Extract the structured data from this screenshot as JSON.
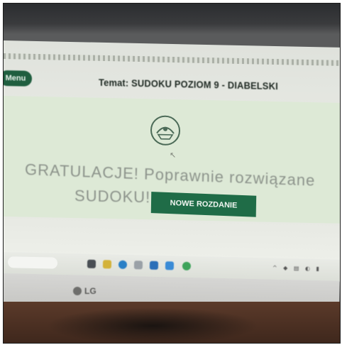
{
  "back_button_label": "Menu",
  "page_title": "Temat: SUDOKU POZIOM 9 - DIABELSKI",
  "message_line1": "GRATULACJE! Poprawnie rozwiązane",
  "message_line2": "SUDOKU!",
  "new_game_button": "NOWE ROZDANIE",
  "monitor_brand": "LG",
  "colors": {
    "accent_green": "#1f6c47",
    "panel_green": "#dde9d6",
    "message_gray": "#8c938b"
  },
  "taskbar_icons": [
    "windows-icon",
    "file-explorer-icon",
    "edge-icon",
    "mail-icon",
    "store-icon",
    "chrome-icon"
  ]
}
